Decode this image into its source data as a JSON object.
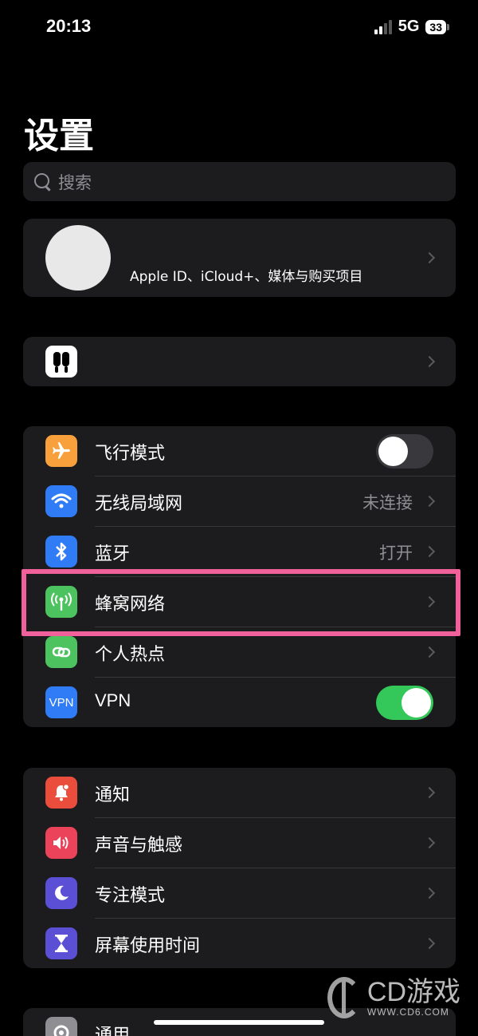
{
  "status": {
    "time": "20:13",
    "network": "5G",
    "battery": "33"
  },
  "title": "设置",
  "search": {
    "placeholder": "搜索"
  },
  "profile": {
    "subtitle": "Apple ID、iCloud+、媒体与购买项目"
  },
  "connectivity": [
    {
      "label": "飞行模式",
      "icon": "airplane-icon",
      "color": "#f7a03c",
      "toggle": false
    },
    {
      "label": "无线局域网",
      "icon": "wifi-icon",
      "color": "#2f7cf6",
      "value": "未连接"
    },
    {
      "label": "蓝牙",
      "icon": "bluetooth-icon",
      "color": "#2f7cf6",
      "value": "打开"
    },
    {
      "label": "蜂窝网络",
      "icon": "antenna-icon",
      "color": "#4cc35e",
      "highlighted": true
    },
    {
      "label": "个人热点",
      "icon": "hotspot-icon",
      "color": "#4cc35e"
    },
    {
      "label": "VPN",
      "icon": "vpn-icon",
      "icon_text": "VPN",
      "color": "#2f7cf6",
      "toggle": true
    }
  ],
  "notifications": [
    {
      "label": "通知",
      "icon": "bell-icon",
      "color": "#eb4d3d"
    },
    {
      "label": "声音与触感",
      "icon": "speaker-icon",
      "color": "#eb445a"
    },
    {
      "label": "专注模式",
      "icon": "moon-icon",
      "color": "#5b4fd6"
    },
    {
      "label": "屏幕使用时间",
      "icon": "hourglass-icon",
      "color": "#5b4fd6"
    }
  ],
  "general": [
    {
      "label": "通用",
      "icon": "gear-icon",
      "color": "#8e8e93"
    }
  ],
  "watermark": {
    "brand": "CD游戏",
    "url": "WWW.CD6.COM"
  }
}
